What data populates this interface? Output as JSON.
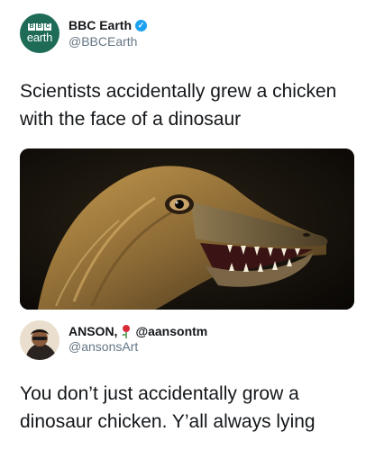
{
  "post": {
    "author": {
      "name": "BBC Earth",
      "handle": "@BBCEarth",
      "verified": true,
      "avatar_boxes": [
        "B",
        "B",
        "C"
      ],
      "avatar_word": "earth"
    },
    "text": "Scientists accidentally grew a chicken with the face of a dinosaur",
    "image": {
      "subject": "dinosaur-faced chicken head"
    }
  },
  "reply": {
    "author": {
      "name": "ANSON,",
      "emoji": "rose-icon",
      "alt_handle": "@aansontm",
      "handle": "@ansonsArt"
    },
    "text": "You don’t just accidentally grow a dinosaur chicken. Y’all always lying"
  },
  "colors": {
    "text": "#14171a",
    "secondary": "#657786",
    "verified": "#1da1f2",
    "bbc_green": "#1e6b57"
  }
}
